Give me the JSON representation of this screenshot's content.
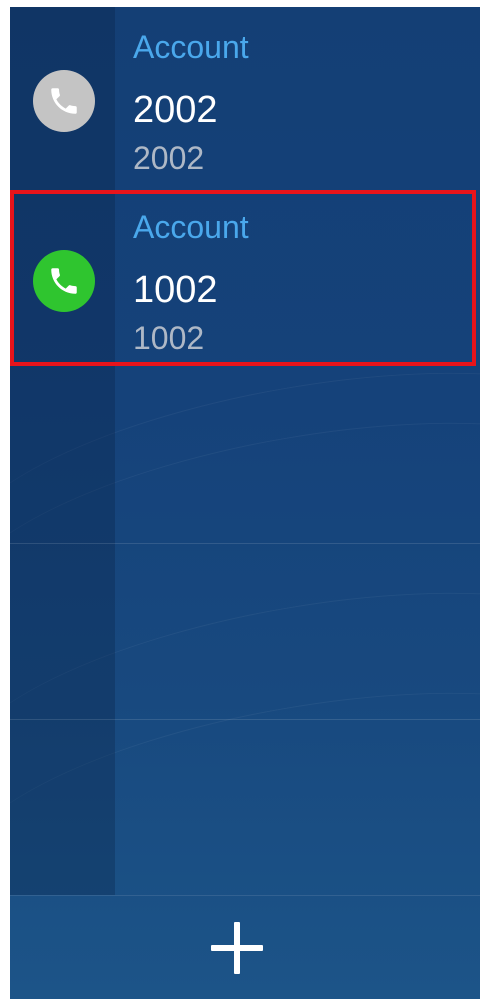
{
  "accounts": [
    {
      "label": "Account",
      "name": "2002",
      "number": "2002",
      "status": "inactive",
      "icon": "phone-icon",
      "icon_color": "#c4c4c4"
    },
    {
      "label": "Account",
      "name": "1002",
      "number": "1002",
      "status": "active",
      "icon": "phone-icon",
      "icon_color": "#2fc52f"
    }
  ],
  "add_button": {
    "icon": "plus-icon"
  },
  "colors": {
    "background": "#15427a",
    "label_accent": "#4aa8ec",
    "highlight": "#e8141b"
  }
}
